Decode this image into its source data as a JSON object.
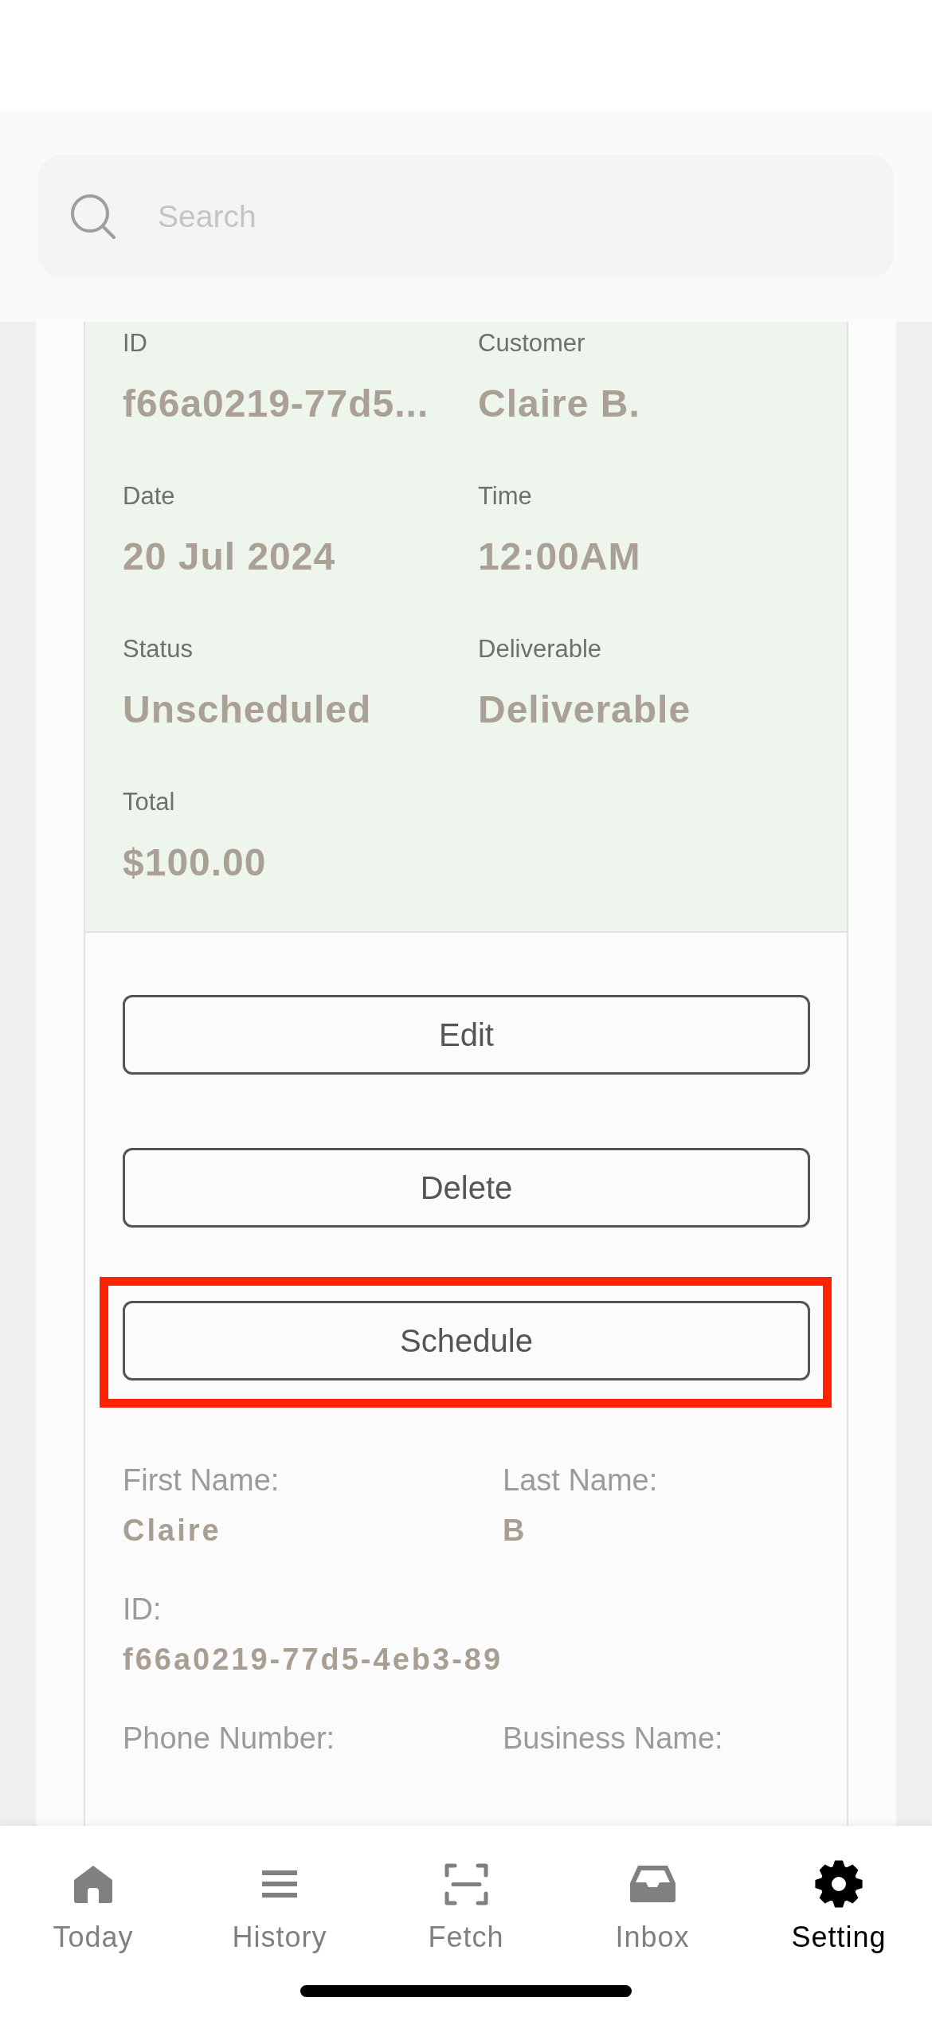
{
  "search": {
    "placeholder": "Search"
  },
  "summary": {
    "fields": [
      {
        "label": "ID",
        "value": "f66a0219-77d5..."
      },
      {
        "label": "Customer",
        "value": "Claire B."
      },
      {
        "label": "Date",
        "value": "20 Jul 2024"
      },
      {
        "label": "Time",
        "value": "12:00AM"
      },
      {
        "label": "Status",
        "value": "Unscheduled"
      },
      {
        "label": "Deliverable",
        "value": "Deliverable"
      },
      {
        "label": "Total",
        "value": "$100.00"
      }
    ]
  },
  "actions": [
    {
      "label": "Edit",
      "highlighted": false
    },
    {
      "label": "Delete",
      "highlighted": false
    },
    {
      "label": "Schedule",
      "highlighted": true
    }
  ],
  "details": {
    "rows": [
      [
        {
          "label": "First Name:",
          "value": "Claire"
        },
        {
          "label": "Last Name:",
          "value": "B"
        }
      ],
      [
        {
          "label": "ID:",
          "value": "f66a0219-77d5-4eb3-89"
        }
      ],
      [
        {
          "label": "Phone Number:"
        },
        {
          "label": "Business Name:"
        }
      ]
    ]
  },
  "tab_bar": {
    "tabs": [
      {
        "label": "Today",
        "selected": false
      },
      {
        "label": "History",
        "selected": false
      },
      {
        "label": "Fetch",
        "selected": false
      },
      {
        "label": "Inbox",
        "selected": false
      },
      {
        "label": "Setting",
        "selected": true
      }
    ]
  }
}
